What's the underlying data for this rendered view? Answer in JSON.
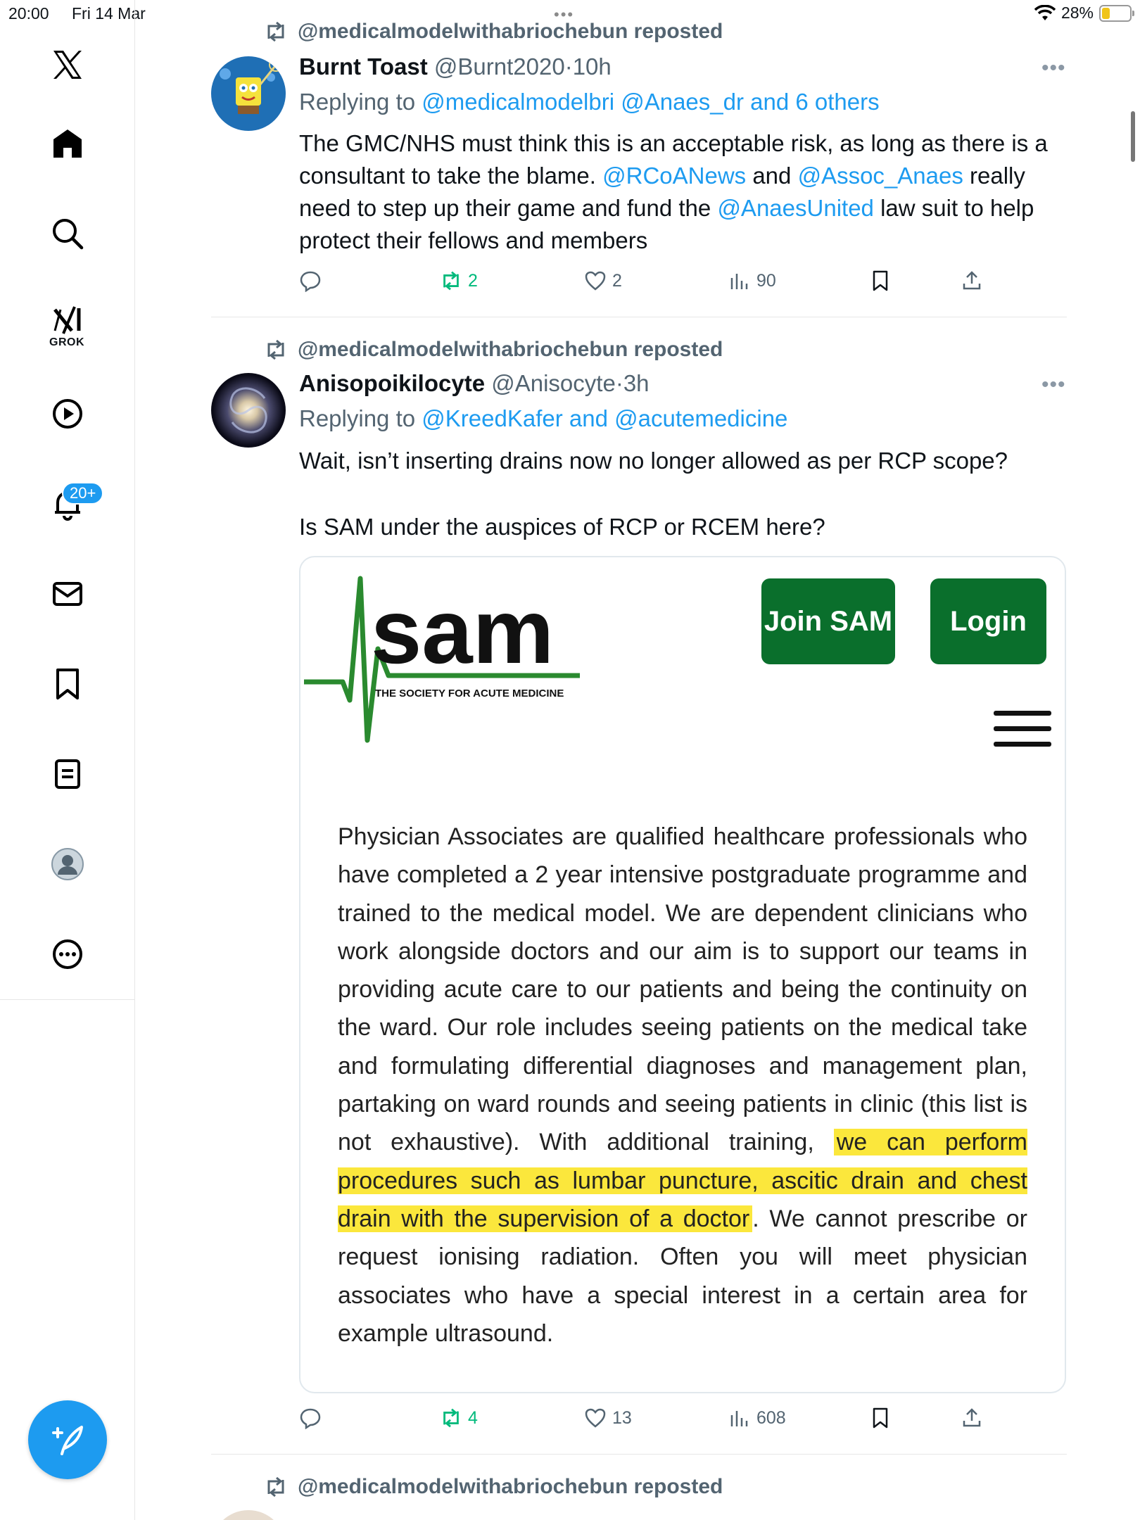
{
  "status_bar": {
    "time": "20:00",
    "date": "Fri 14 Mar",
    "battery": "28%",
    "battery_level": 0.28
  },
  "sidebar": {
    "grok_label": "GROK",
    "notifications_badge": "20+"
  },
  "tweets": [
    {
      "repost_label": "@medicalmodelwithabriochebun reposted",
      "name": "Burnt Toast",
      "handle": "@Burnt2020",
      "dot": "·",
      "time": "10h",
      "reply_prefix": "Replying to",
      "reply_targets": "@medicalmodelbri @Anaes_dr and 6 others",
      "body": [
        {
          "t": "The GMC/NHS must think this is an acceptable risk, as long as there is a consultant to take the blame. "
        },
        {
          "t": "@RCoANews",
          "link": true
        },
        {
          "t": " and "
        },
        {
          "t": "@Assoc_Anaes",
          "link": true
        },
        {
          "t": " really need to step up their game and fund the "
        },
        {
          "t": "@AnaesUnited",
          "link": true
        },
        {
          "t": " law suit to help protect their fellows and members"
        }
      ],
      "reposts": "2",
      "likes": "2",
      "views": "90"
    },
    {
      "repost_label": "@medicalmodelwithabriochebun reposted",
      "name": "Anisopoikilocyte",
      "handle": "@Anisocyte",
      "dot": "·",
      "time": "3h",
      "reply_prefix": "Replying to",
      "reply_targets": "@KreedKafer and @acutemedicine",
      "body_line1": "Wait, isn’t inserting drains now no longer allowed as per RCP scope?",
      "body_line2": "Is SAM under the auspices of RCP or RCEM here?",
      "reposts": "4",
      "likes": "13",
      "views": "608"
    },
    {
      "repost_label": "@medicalmodelwithabriochebun reposted"
    }
  ],
  "sam_card": {
    "logo_word": "sam",
    "logo_tagline": "THE SOCIETY FOR ACUTE MEDICINE",
    "join_button": "Join SAM",
    "login_button": "Login",
    "text_before": "Physician Associates are qualified healthcare professionals who have completed a 2 year intensive postgraduate programme and trained to the medical model. We are dependent clinicians who work alongside doctors and our aim is to support our teams in providing acute care to our patients and being the continuity on the ward. Our role includes seeing patients on the medical take and formulating differential diagnoses and management plan, partaking on ward rounds and seeing patients in clinic (this list is not exhaustive). With additional training, ",
    "text_highlight": "we can perform procedures such as lumbar puncture, ascitic drain and chest drain with the supervision of a doctor",
    "text_after": ". We cannot prescribe or request ionising radiation. Often you will meet physician associates who have a special interest in a certain area for example ultrasound.",
    "colors": {
      "green": "#0a6f2c",
      "highlight": "#fbe73c"
    }
  },
  "colors": {
    "accent": "#1d9bf0",
    "repost_green": "#00ba7c",
    "muted": "#536471"
  }
}
